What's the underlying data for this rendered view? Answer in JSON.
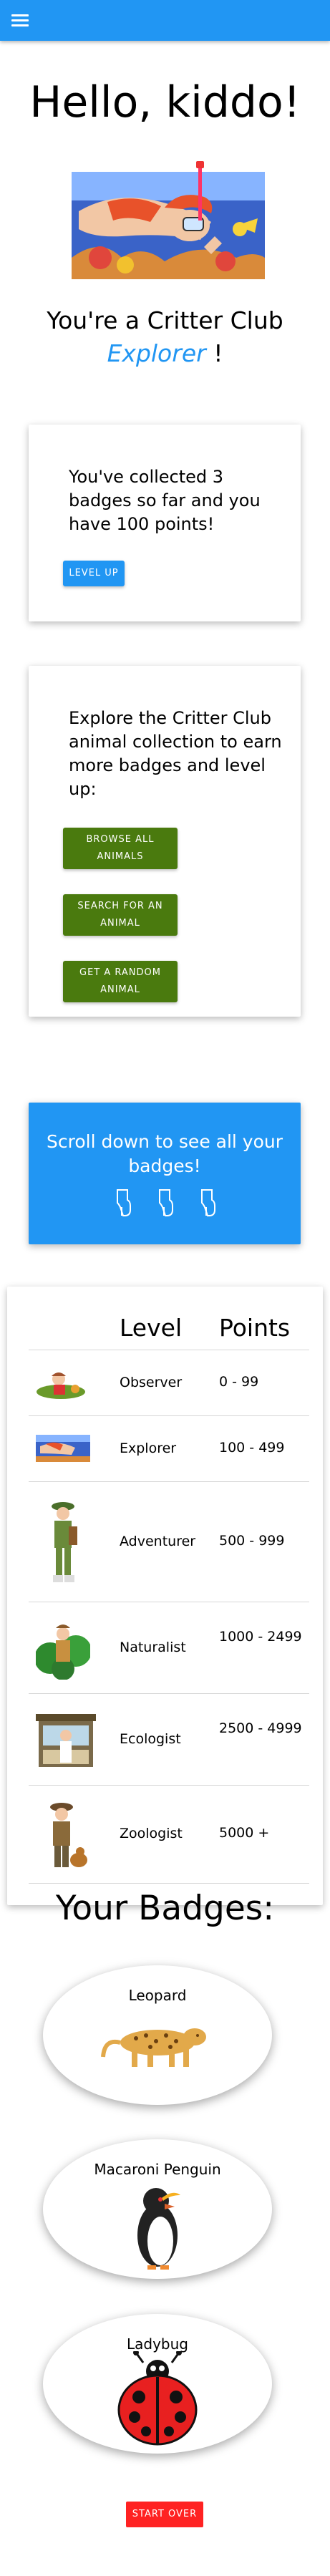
{
  "nav": {
    "menu_icon": "hamburger-menu-icon",
    "color": "#2196f3"
  },
  "greeting": "Hello, kiddo!",
  "rank": {
    "prefix": "You're a Critter Club",
    "level": "Explorer",
    "suffix": "!"
  },
  "progress_card": {
    "text": "You've collected 3 badges so far and you have 100 points!",
    "button": "LEVEL UP"
  },
  "explore_card": {
    "text": "Explore the Critter Club animal collection to earn more badges and level up:",
    "buttons": [
      "BROWSE ALL ANIMALS",
      "SEARCH FOR AN ANIMAL",
      "GET A RANDOM ANIMAL"
    ]
  },
  "scroll_card": {
    "text": "Scroll down to see all your badges!",
    "icon": "pointing-down-hand-icon"
  },
  "levels_table": {
    "headers": [
      "Level",
      "Points"
    ],
    "rows": [
      {
        "level": "Observer",
        "points": "0 - 99"
      },
      {
        "level": "Explorer",
        "points": "100 - 499"
      },
      {
        "level": "Adventurer",
        "points": "500 - 999"
      },
      {
        "level": "Naturalist",
        "points": "1000 - 2499"
      },
      {
        "level": "Ecologist",
        "points": "2500 - 4999"
      },
      {
        "level": "Zoologist",
        "points": "5000 +"
      }
    ]
  },
  "badges": {
    "title": "Your Badges:",
    "items": [
      {
        "name": "Leopard"
      },
      {
        "name": "Macaroni Penguin"
      },
      {
        "name": "Ladybug"
      }
    ]
  },
  "start_over": "START OVER",
  "colors": {
    "blue": "#2196f3",
    "green": "#4a7a0e",
    "red": "#ff2222"
  }
}
